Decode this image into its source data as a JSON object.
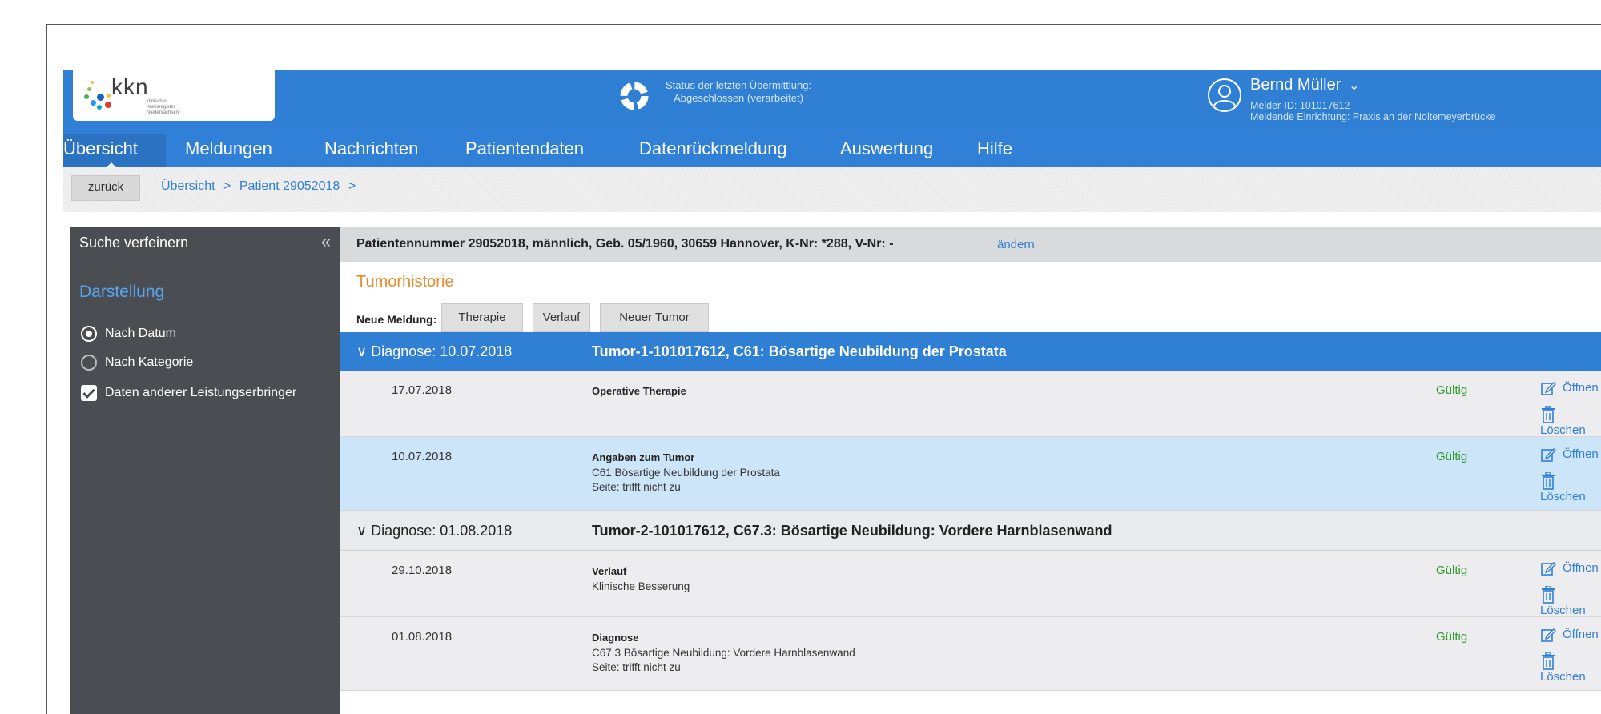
{
  "header": {
    "logo_text": "kkn",
    "logo_subtext": "klinisches Krebsregister Niedersachsen",
    "status_line1": "Status der letzten Übermittlung:",
    "status_line2": "Abgeschlossen (verarbeitet)",
    "user_name": "Bernd Müller",
    "user_caret": "⌄",
    "melder_id": "Melder-ID: 101017612",
    "einrichtung": "Meldende Einrichtung: Praxis an der Noltemeyerbrücke"
  },
  "nav": {
    "items": [
      "Übersicht",
      "Meldungen",
      "Nachrichten",
      "Patientendaten",
      "Datenrückmeldung",
      "Auswertung",
      "Hilfe"
    ]
  },
  "breadcrumb": {
    "back": "zurück",
    "item1": "Übersicht",
    "sep": ">",
    "item2": "Patient 29052018"
  },
  "sidebar": {
    "title": "Suche verfeinern",
    "collapse": "«",
    "section": "Darstellung",
    "radio1": "Nach Datum",
    "radio2": "Nach Kategorie",
    "checkbox": "Daten anderer Leistungserbringer"
  },
  "patient": {
    "info": "Patientennummer 29052018, männlich, Geb. 05/1960, 30659 Hannover, K-Nr: *288, V-Nr: -",
    "change_link": "ändern"
  },
  "tumor_history": {
    "title": "Tumorhistorie",
    "new_label": "Neue Meldung:",
    "buttons": [
      "Therapie",
      "Verlauf",
      "Neuer Tumor"
    ]
  },
  "diagnoses": [
    {
      "date": "∨ Diagnose: 10.07.2018",
      "text": "Tumor-1-101017612, C61: Bösartige Neubildung der Prostata",
      "entries": [
        {
          "date": "17.07.2018",
          "title": "Operative Therapie",
          "lines": [],
          "status": "Gültig",
          "open": "Öffnen",
          "delete": "Löschen"
        },
        {
          "date": "10.07.2018",
          "title": "Angaben zum Tumor",
          "lines": [
            "C61 Bösartige Neubildung der Prostata",
            "Seite: trifft nicht zu"
          ],
          "status": "Gültig",
          "open": "Öffnen",
          "delete": "Löschen"
        }
      ]
    },
    {
      "date": "∨ Diagnose: 01.08.2018",
      "text": "Tumor-2-101017612, C67.3: Bösartige Neubildung: Vordere Harnblasenwand",
      "entries": [
        {
          "date": "29.10.2018",
          "title": "Verlauf",
          "lines": [
            "Klinische Besserung"
          ],
          "status": "Gültig",
          "open": "Öffnen",
          "delete": "Löschen"
        },
        {
          "date": "01.08.2018",
          "title": "Diagnose",
          "lines": [
            "C67.3 Bösartige Neubildung: Vordere Harnblasenwand",
            "Seite: trifft nicht zu"
          ],
          "status": "Gültig",
          "open": "Öffnen",
          "delete": "Löschen"
        }
      ]
    }
  ],
  "colors": {
    "brand_blue": "#2f7fd4",
    "accent_orange": "#e98a2e",
    "status_green": "#2a9b2a",
    "sidebar_dark": "#4a4d52"
  }
}
